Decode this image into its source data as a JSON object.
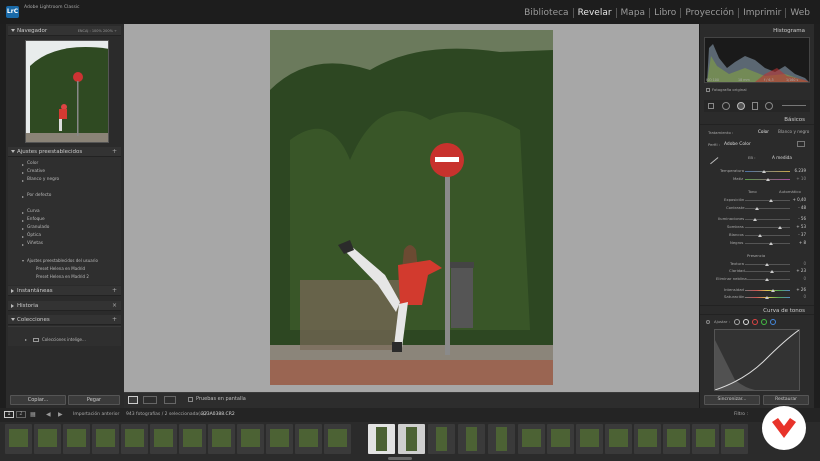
{
  "app": {
    "title": "Adobe Lightroom Classic",
    "logo": "LrC"
  },
  "modules": [
    {
      "label": "Biblioteca"
    },
    {
      "label": "Revelar",
      "active": true
    },
    {
      "label": "Mapa"
    },
    {
      "label": "Libro"
    },
    {
      "label": "Proyección"
    },
    {
      "label": "Imprimir"
    },
    {
      "label": "Web"
    }
  ],
  "left": {
    "navigator": {
      "title": "Navegador",
      "options": "ENCAJ  :  100%   200%   ÷"
    },
    "presets": {
      "title": "Ajustes preestablecidos",
      "items": [
        "Color",
        "Creative",
        "Blanco y negro",
        "Por defecto",
        "Curva",
        "Enfoque",
        "Granulado",
        "Óptica",
        "Viñetas"
      ],
      "user_group": "Ajustes preestablecidos del usuario",
      "user_items": [
        "Preset Helena en Madrid",
        "Preset Helena en Madrid 2"
      ]
    },
    "snapshots": "Instantáneas",
    "history": "Historia",
    "collections": {
      "title": "Colecciones",
      "item": "Colecciones intelige..."
    },
    "copy_button": "Copiar...",
    "paste_button": "Pegar"
  },
  "toolbar": {
    "softproof": "Pruebas en pantalla"
  },
  "right": {
    "histogram": {
      "title": "Histograma",
      "iso": "ISO 100",
      "focal": "18 mm",
      "aperture": "f / 6,3",
      "shutter": "1/160 s",
      "original": "Fotografía original"
    },
    "basics": {
      "title": "Básicos",
      "treatment": "Tratamiento :",
      "color": "Color",
      "bw": "Blanco y negro",
      "profile_label": "Perfil :",
      "profile": "Adobe Color",
      "wb_label": "EB :",
      "wb": "A medida",
      "temp_label": "Temperatura",
      "temp": "6.239",
      "tint_label": "Matiz",
      "tint": "+ 10",
      "tone": "Tono",
      "auto": "Automático",
      "exposure_label": "Exposición",
      "exposure": "+ 0,40",
      "contrast_label": "Contraste",
      "contrast": "- 48",
      "highlights_label": "Iluminaciones",
      "highlights": "- 56",
      "shadows_label": "Sombras",
      "shadows": "+ 53",
      "whites_label": "Blancos",
      "whites": "- 37",
      "blacks_label": "Negros",
      "blacks": "+ 8",
      "presence": "Presencia",
      "texture_label": "Textura",
      "texture": "0",
      "clarity_label": "Claridad",
      "clarity": "+ 23",
      "dehaze_label": "Eliminar neblina",
      "dehaze": "0",
      "vibrance_label": "Intensidad",
      "vibrance": "+ 26",
      "saturation_label": "Saturación",
      "saturation": "0"
    },
    "tonecurve": {
      "title": "Curva de tonos",
      "adjust": "Ajustar :"
    },
    "sync_button": "Sincronizar...",
    "reset_button": "Restaurar"
  },
  "filmbar": {
    "pages": [
      "1",
      "2"
    ],
    "source": "Importación anterior",
    "count": "943 fotografías / 2 seleccionada(s) /",
    "filename": "323A0388.CR2",
    "filter": "Filtro :"
  },
  "colors": {
    "accent": "#e3e3e3",
    "brand": "#e8332a"
  }
}
